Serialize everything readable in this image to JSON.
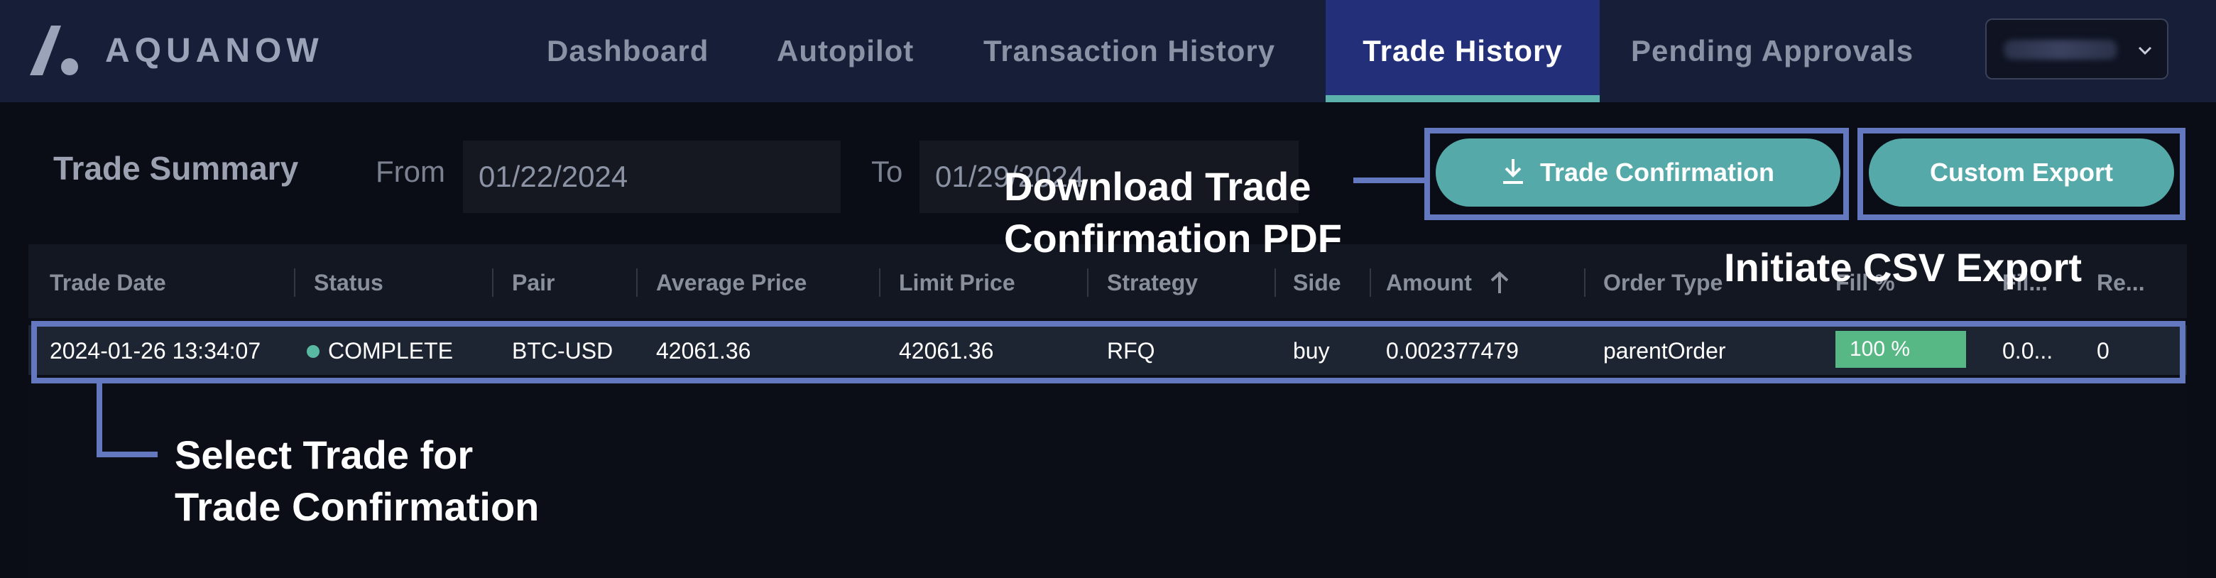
{
  "brand": {
    "name": "AQUANOW"
  },
  "nav": {
    "items": [
      {
        "label": "Dashboard"
      },
      {
        "label": "Autopilot"
      },
      {
        "label": "Transaction History"
      },
      {
        "label": "Trade History",
        "active": true
      },
      {
        "label": "Pending Approvals"
      }
    ],
    "account_icon": "chevron-down-icon"
  },
  "summary": {
    "title": "Trade Summary",
    "from_label": "From",
    "from_value": "01/22/2024",
    "to_label": "To",
    "to_value": "01/29/2024"
  },
  "buttons": {
    "trade_confirmation": "Trade Confirmation",
    "trade_confirmation_icon": "download-icon",
    "custom_export": "Custom Export"
  },
  "table": {
    "columns": [
      "Trade Date",
      "Status",
      "Pair",
      "Average Price",
      "Limit Price",
      "Strategy",
      "Side",
      "Amount",
      "Order Type",
      "Fill %",
      "Fil...",
      "Re..."
    ],
    "sort_icon": "arrow-up-icon",
    "rows": [
      {
        "trade_date": "2024-01-26 13:34:07",
        "status": "COMPLETE",
        "pair": "BTC-USD",
        "average_price": "42061.36",
        "limit_price": "42061.36",
        "strategy": "RFQ",
        "side": "buy",
        "amount": "0.002377479",
        "order_type": "parentOrder",
        "fill_pct": "100 %",
        "fill_fraction": 1.0,
        "filled": "0.0...",
        "remaining": "0"
      }
    ]
  },
  "annotations": {
    "download_line1": "Download Trade",
    "download_line2": "Confirmation PDF",
    "csv": "Initiate CSV Export",
    "select_line1": "Select Trade for",
    "select_line2": "Trade Confirmation"
  },
  "colors": {
    "nav_bg": "#161e38",
    "nav_active": "#233079",
    "accent_teal": "#55a9a8",
    "highlight": "#6478c0",
    "status_green": "#58b8a2",
    "fill_green": "#58b885"
  }
}
